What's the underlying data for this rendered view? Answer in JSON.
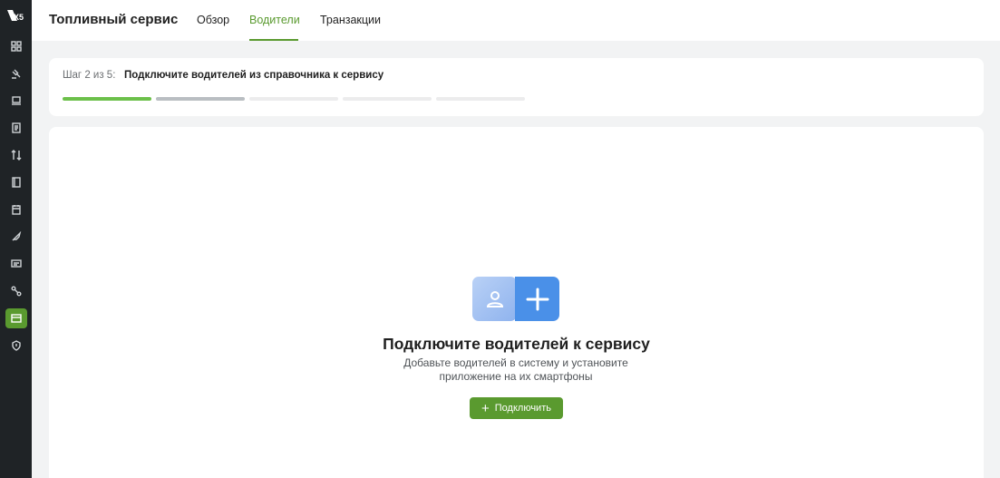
{
  "sidebar": {
    "logo_text": "X5",
    "items": [
      {
        "icon": "dashboard-icon"
      },
      {
        "icon": "gavel-icon"
      },
      {
        "icon": "laptop-icon"
      },
      {
        "icon": "document-icon"
      },
      {
        "icon": "exchange-icon"
      },
      {
        "icon": "book-icon"
      },
      {
        "icon": "calendar-icon"
      },
      {
        "icon": "rocket-icon"
      },
      {
        "icon": "message-icon"
      },
      {
        "icon": "route-icon"
      },
      {
        "icon": "card-icon",
        "active": true
      },
      {
        "icon": "shield-icon"
      }
    ]
  },
  "header": {
    "title": "Топливный сервис",
    "tabs": [
      {
        "label": "Обзор",
        "active": false
      },
      {
        "label": "Водители",
        "active": true
      },
      {
        "label": "Транзакции",
        "active": false
      }
    ]
  },
  "stepper": {
    "step_label": "Шаг 2 из 5:",
    "step_description": "Подключите водителей из справочника к сервису",
    "current": 2,
    "total": 5,
    "colors": {
      "done": "#6cc04a",
      "current": "#b9bec2",
      "todo": "#ececed"
    }
  },
  "empty_state": {
    "illustration": [
      "user-icon",
      "plus-icon"
    ],
    "title": "Подключите водителей к сервису",
    "subtitle": "Добавьте водителей в систему и установите приложение на их смартфоны",
    "button_label": "Подключить"
  },
  "colors": {
    "accent": "#5a9a2f",
    "illustration_blue": "#4a90e8"
  }
}
